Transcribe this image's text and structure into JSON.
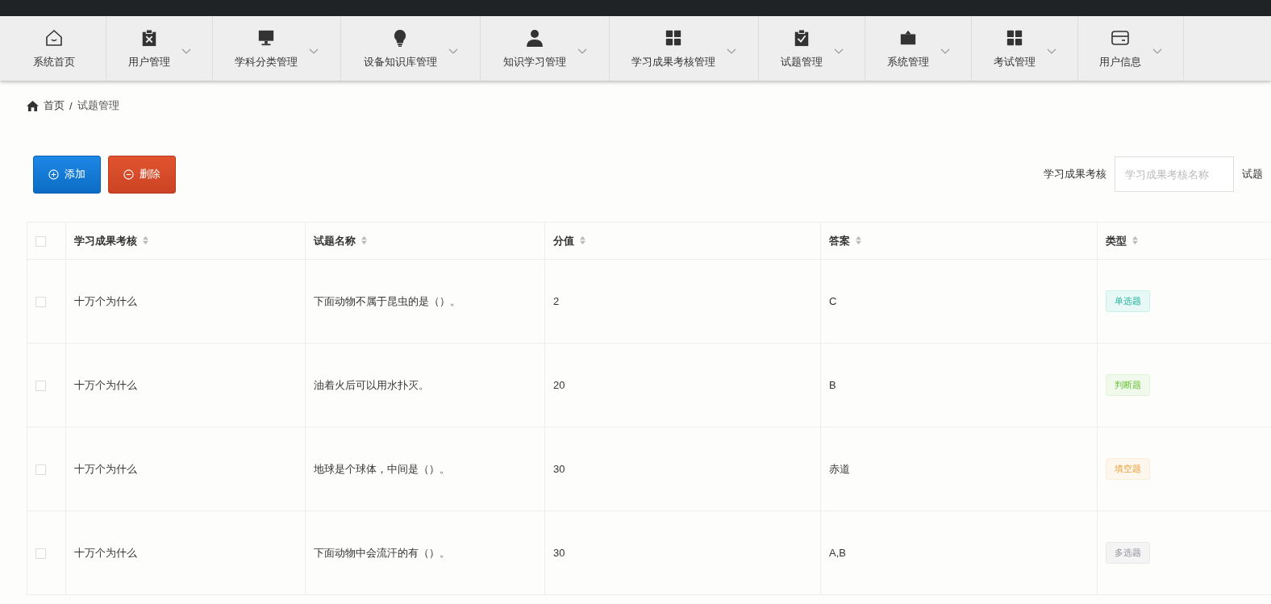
{
  "nav": [
    {
      "label": "系统首页",
      "dropdown": false
    },
    {
      "label": "用户管理",
      "dropdown": true
    },
    {
      "label": "学科分类管理",
      "dropdown": true
    },
    {
      "label": "设备知识库管理",
      "dropdown": true
    },
    {
      "label": "知识学习管理",
      "dropdown": true
    },
    {
      "label": "学习成果考核管理",
      "dropdown": true
    },
    {
      "label": "试题管理",
      "dropdown": true
    },
    {
      "label": "系统管理",
      "dropdown": true
    },
    {
      "label": "考试管理",
      "dropdown": true
    },
    {
      "label": "用户信息",
      "dropdown": true
    }
  ],
  "breadcrumb": {
    "home": "首页",
    "separator": "/",
    "current": "试题管理"
  },
  "buttons": [
    {
      "label": "添加",
      "kind": "add"
    },
    {
      "label": "删除",
      "kind": "delete"
    }
  ],
  "search": [
    {
      "label": "学习成果考核",
      "placeholder": "学习成果考核名称"
    },
    {
      "label": "试题"
    }
  ],
  "table": {
    "select_all_checked": false,
    "columns": [
      "学习成果考核",
      "试题名称",
      "分值",
      "答案",
      "类型"
    ],
    "rows": [
      {
        "checked": false,
        "cells": [
          "十万个为什么",
          "下面动物不属于昆虫的是（）。",
          "2",
          "C"
        ],
        "type": {
          "label": "单选题",
          "kind": "single"
        }
      },
      {
        "checked": false,
        "cells": [
          "十万个为什么",
          "油着火后可以用水扑灭。",
          "20",
          "B"
        ],
        "type": {
          "label": "判断题",
          "kind": "judge"
        }
      },
      {
        "checked": false,
        "cells": [
          "十万个为什么",
          "地球是个球体，中间是（）。",
          "30",
          "赤道"
        ],
        "type": {
          "label": "填空题",
          "kind": "fill"
        }
      },
      {
        "checked": false,
        "cells": [
          "十万个为什么",
          "下面动物中会流汗的有（）。",
          "30",
          "A,B"
        ],
        "type": {
          "label": "多选题",
          "kind": "multi"
        }
      }
    ]
  }
}
